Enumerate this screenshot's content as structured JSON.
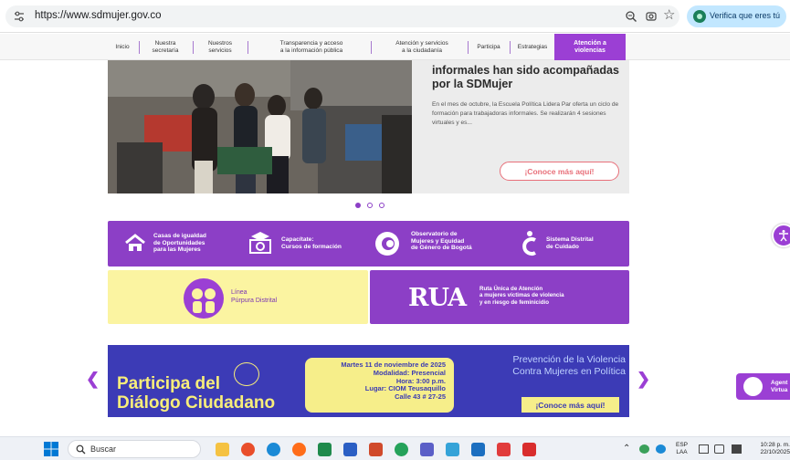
{
  "browser": {
    "url": "https://www.sdmujer.gov.co",
    "verify_label": "Verifica que eres tú"
  },
  "nav": {
    "items": [
      {
        "label": "Inicio"
      },
      {
        "label": "Nuestra\nsecretaría"
      },
      {
        "label": "Nuestros\nservicios"
      },
      {
        "label": "Transparencia y acceso\na la información pública"
      },
      {
        "label": "Atención y servicios\na la ciudadanía"
      },
      {
        "label": "Participa"
      },
      {
        "label": "Estrategias"
      }
    ],
    "active_label": "Atención a\nviolencias"
  },
  "hero": {
    "title": "informales han sido acompañadas por la SDMujer",
    "description": "En el mes de octubre, la Escuela Política Lidera Par oferta un ciclo de formación para trabajadoras informales. Se realizarán 4 sesiones virtuales y es...",
    "cta": "¡Conoce más aquí!"
  },
  "services": [
    {
      "label": "Casas de igualdad\nde Oportunidades\npara las Mujeres"
    },
    {
      "label": "Capacítate:\nCursos de formación"
    },
    {
      "label": "Observatorio de\nMujeres y Equidad\nde Género de Bogotá"
    },
    {
      "label": "Sistema Distrital\nde Cuidado"
    }
  ],
  "linea": {
    "label": "Línea\nPúrpura Distrital"
  },
  "rua": {
    "logo": "RUA",
    "label": "Ruta Única de Atención\na mujeres víctimas de violencia\ny en riesgo de feminicidio"
  },
  "banner": {
    "title": "Participa del\nDiálogo Ciudadano",
    "event": "Martes 11 de noviembre de 2025\nModalidad: Presencial\nHora: 3:00 p.m.\nLugar: CIOM Teusaquillo\nCalle 43 # 27-25",
    "headline": "Prevención de la Violencia\nContra Mujeres en Política",
    "cta": "¡Conoce más aquí!"
  },
  "agent": {
    "label": "Agent\nVirtua"
  },
  "taskbar": {
    "search_placeholder": "Buscar",
    "lang": "ESP\nLAA",
    "time": "10:28 p. m.\n22/10/2025"
  },
  "colors": {
    "purple": "#8c3fc6",
    "nav_active": "#9b3fd4",
    "yellow": "#fbf4a1",
    "banner_blue": "#3c3bb6",
    "cta_coral": "#e8707a"
  }
}
